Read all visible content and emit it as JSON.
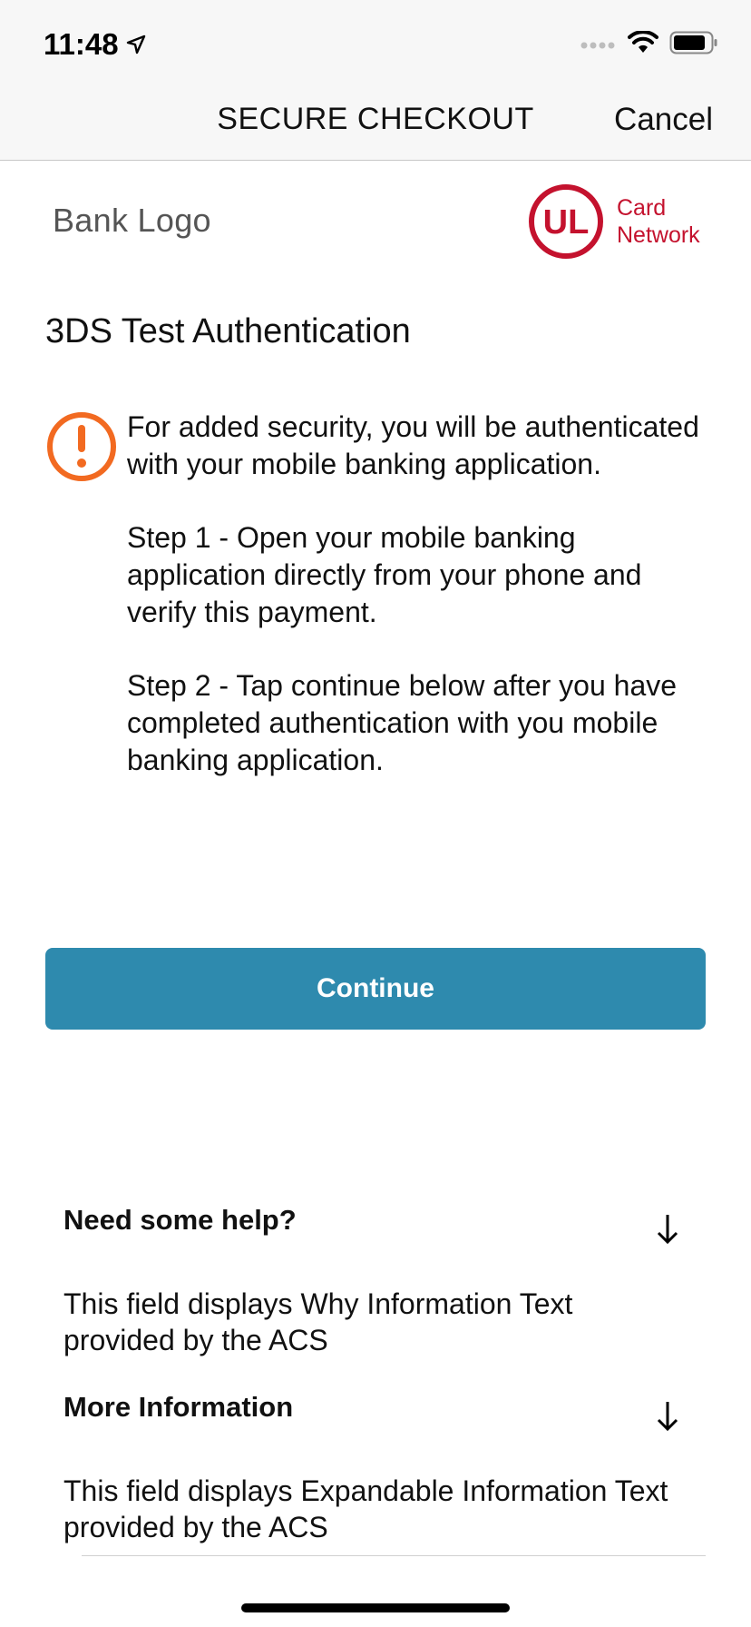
{
  "status_bar": {
    "time": "11:48",
    "icons": [
      "location-arrow-icon",
      "signal-icon",
      "wifi-icon",
      "battery-icon"
    ]
  },
  "nav": {
    "title": "SECURE CHECKOUT",
    "cancel_label": "Cancel"
  },
  "header": {
    "bank_logo_text": "Bank Logo",
    "network_logo_text": "UL",
    "network_label_line1": "Card",
    "network_label_line2": "Network"
  },
  "main": {
    "title": "3DS Test Authentication",
    "icon": "warning-icon",
    "paragraphs": [
      "For added security, you will be authenticated with your mobile banking application.",
      "Step 1 - Open your mobile banking application directly from your phone and verify this payment.",
      "Step 2 - Tap continue below after you have completed authentication with you mobile banking application."
    ],
    "continue_label": "Continue"
  },
  "help": {
    "why_title": "Need some help?",
    "why_text": "This field displays Why Information Text provided by the ACS",
    "expand_title": "More Information",
    "expand_text": "This field displays Expandable Information Text provided by the ACS"
  },
  "colors": {
    "accent_button": "#2e8aae",
    "warning_orange": "#f26a21",
    "network_red": "#c4122e"
  }
}
